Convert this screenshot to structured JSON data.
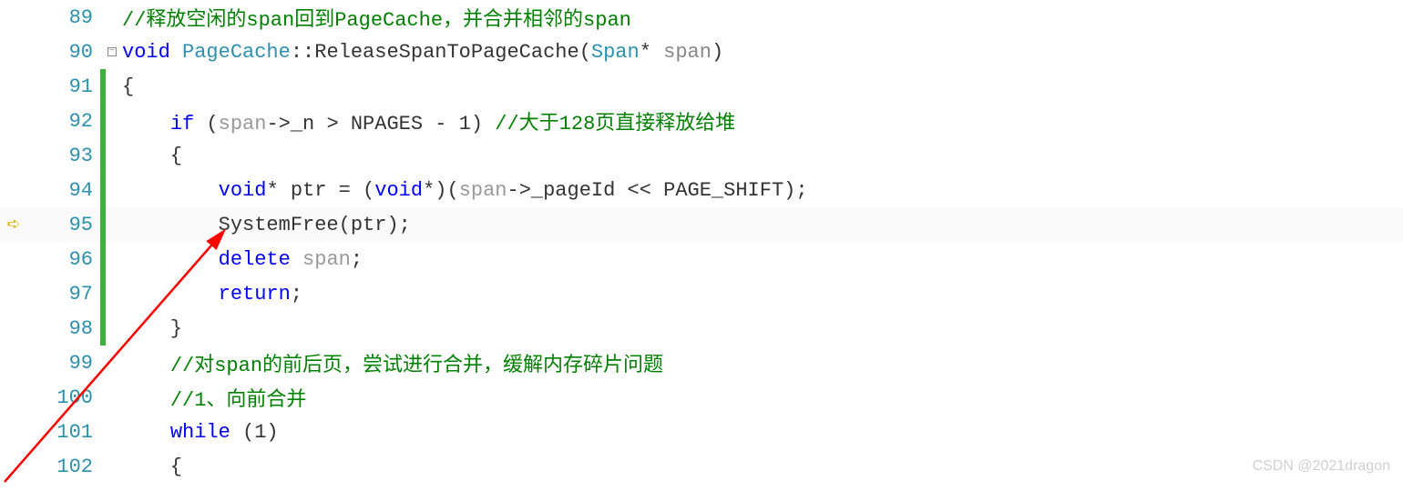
{
  "editor": {
    "lines": [
      {
        "num": "89",
        "change": false,
        "marker": "",
        "tokens": [
          {
            "t": "comment",
            "v": "//释放空闲的span回到PageCache，并合并相邻的span"
          }
        ]
      },
      {
        "num": "90",
        "change": false,
        "marker": "collapse",
        "tokens": [
          {
            "t": "keyword",
            "v": "void"
          },
          {
            "t": "punct",
            "v": " "
          },
          {
            "t": "type",
            "v": "PageCache"
          },
          {
            "t": "punct",
            "v": "::ReleaseSpanToPageCache("
          },
          {
            "t": "type",
            "v": "Span"
          },
          {
            "t": "punct",
            "v": "* "
          },
          {
            "t": "param",
            "v": "span"
          },
          {
            "t": "punct",
            "v": ")"
          }
        ]
      },
      {
        "num": "91",
        "change": true,
        "marker": "",
        "tokens": [
          {
            "t": "punct",
            "v": "{"
          }
        ]
      },
      {
        "num": "92",
        "change": true,
        "marker": "",
        "tokens": [
          {
            "t": "punct",
            "v": "    "
          },
          {
            "t": "keyword",
            "v": "if"
          },
          {
            "t": "punct",
            "v": " ("
          },
          {
            "t": "ident-gray",
            "v": "span"
          },
          {
            "t": "punct",
            "v": "->_n > NPAGES - 1) "
          },
          {
            "t": "comment",
            "v": "//大于128页直接释放给堆"
          }
        ]
      },
      {
        "num": "93",
        "change": true,
        "marker": "",
        "tokens": [
          {
            "t": "punct",
            "v": "    {"
          }
        ]
      },
      {
        "num": "94",
        "change": true,
        "marker": "",
        "tokens": [
          {
            "t": "punct",
            "v": "        "
          },
          {
            "t": "keyword",
            "v": "void"
          },
          {
            "t": "punct",
            "v": "* ptr = ("
          },
          {
            "t": "keyword",
            "v": "void"
          },
          {
            "t": "punct",
            "v": "*)("
          },
          {
            "t": "ident-gray",
            "v": "span"
          },
          {
            "t": "punct",
            "v": "->_pageId << PAGE_SHIFT);"
          }
        ]
      },
      {
        "num": "95",
        "change": true,
        "marker": "",
        "current": true,
        "bp": true,
        "tokens": [
          {
            "t": "punct",
            "v": "        SystemFree(ptr);"
          }
        ]
      },
      {
        "num": "96",
        "change": true,
        "marker": "",
        "tokens": [
          {
            "t": "punct",
            "v": "        "
          },
          {
            "t": "keyword",
            "v": "delete"
          },
          {
            "t": "punct",
            "v": " "
          },
          {
            "t": "ident-gray",
            "v": "span"
          },
          {
            "t": "punct",
            "v": ";"
          }
        ]
      },
      {
        "num": "97",
        "change": true,
        "marker": "",
        "tokens": [
          {
            "t": "punct",
            "v": "        "
          },
          {
            "t": "keyword",
            "v": "return"
          },
          {
            "t": "punct",
            "v": ";"
          }
        ]
      },
      {
        "num": "98",
        "change": true,
        "marker": "",
        "tokens": [
          {
            "t": "punct",
            "v": "    }"
          }
        ]
      },
      {
        "num": "99",
        "change": false,
        "marker": "",
        "tokens": [
          {
            "t": "punct",
            "v": "    "
          },
          {
            "t": "comment",
            "v": "//对span的前后页，尝试进行合并，缓解内存碎片问题"
          }
        ]
      },
      {
        "num": "100",
        "change": false,
        "marker": "",
        "tokens": [
          {
            "t": "punct",
            "v": "    "
          },
          {
            "t": "comment",
            "v": "//1、向前合并"
          }
        ]
      },
      {
        "num": "101",
        "change": false,
        "marker": "",
        "tokens": [
          {
            "t": "punct",
            "v": "    "
          },
          {
            "t": "keyword",
            "v": "while"
          },
          {
            "t": "punct",
            "v": " (1)"
          }
        ]
      },
      {
        "num": "102",
        "change": false,
        "marker": "",
        "tokens": [
          {
            "t": "punct",
            "v": "    {"
          }
        ]
      }
    ]
  },
  "watermark": "CSDN @2021dragon"
}
